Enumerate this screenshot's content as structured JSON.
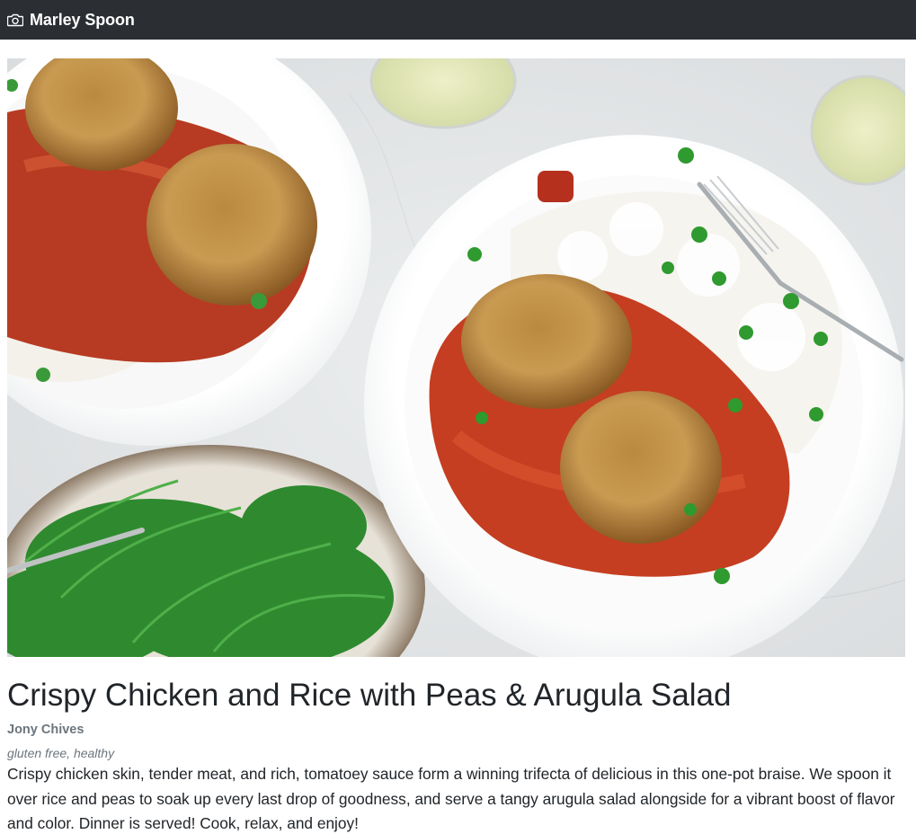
{
  "navbar": {
    "brand_icon": "camera-icon",
    "brand_name": "Marley Spoon",
    "background_color": "#2b2f33"
  },
  "recipe": {
    "image_description_icon": "food-photo",
    "title": "Crispy Chicken and Rice with Peas & Arugula Salad",
    "author": "Jony Chives",
    "tags": "gluten free, healthy",
    "description": "Crispy chicken skin, tender meat, and rich, tomatoey sauce form a winning trifecta of delicious in this one-pot braise. We spoon it over rice and peas to soak up every last drop of goodness, and serve a tangy arugula salad alongside for a vibrant boost of flavor and color. Dinner is served! Cook, relax, and enjoy!"
  }
}
